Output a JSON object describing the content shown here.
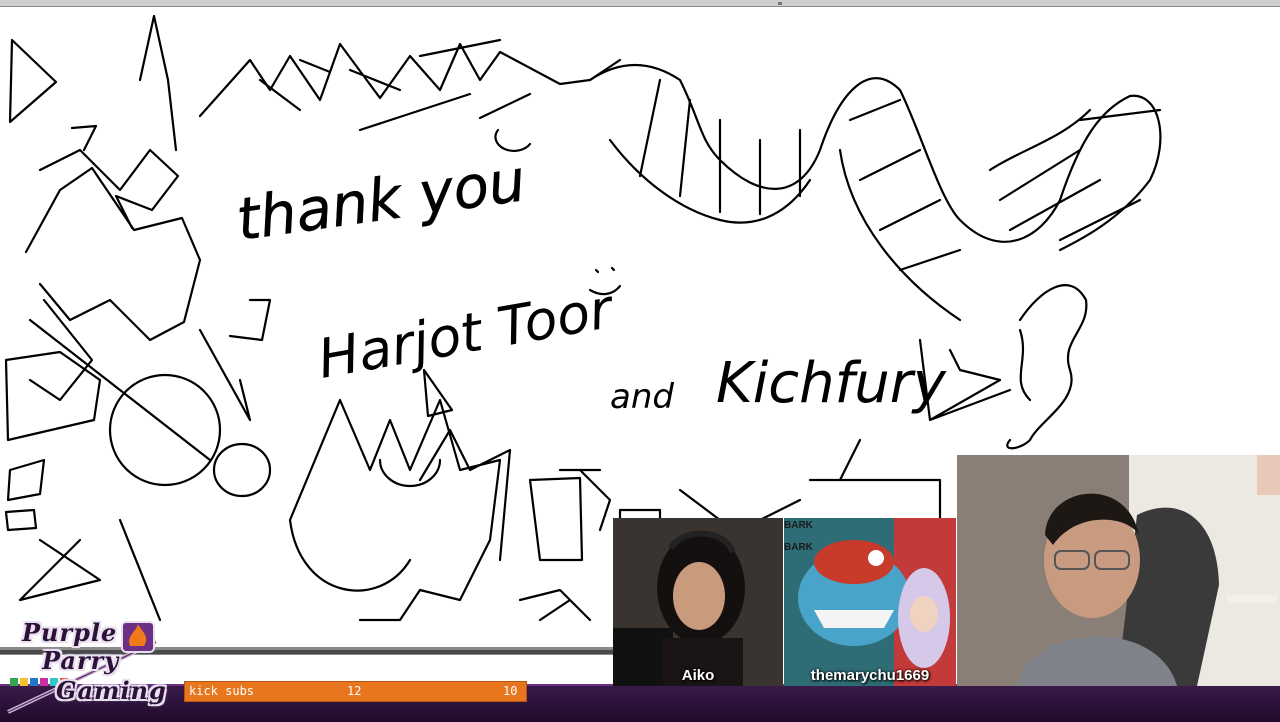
{
  "canvas": {
    "text_thank_you": "thank you",
    "text_harjot": "Harjot Toor",
    "text_and": "and",
    "text_kichfury": "Kichfury"
  },
  "overlay": {
    "logo": {
      "line1": "Purple",
      "line2": "Parry",
      "line3": "Gaming"
    },
    "sub_goal": {
      "label": "kick subs",
      "current": "12",
      "goal": "10",
      "progress": 1.0,
      "color": "#e8761f"
    }
  },
  "webcams": {
    "aiko": {
      "name": "Aiko"
    },
    "mary": {
      "name": "themarychu1669",
      "bark1": "BARK",
      "bark2": "BARK"
    }
  },
  "colors": {
    "accent": "#6b2f86",
    "bar_bg": "#2a0f36"
  }
}
